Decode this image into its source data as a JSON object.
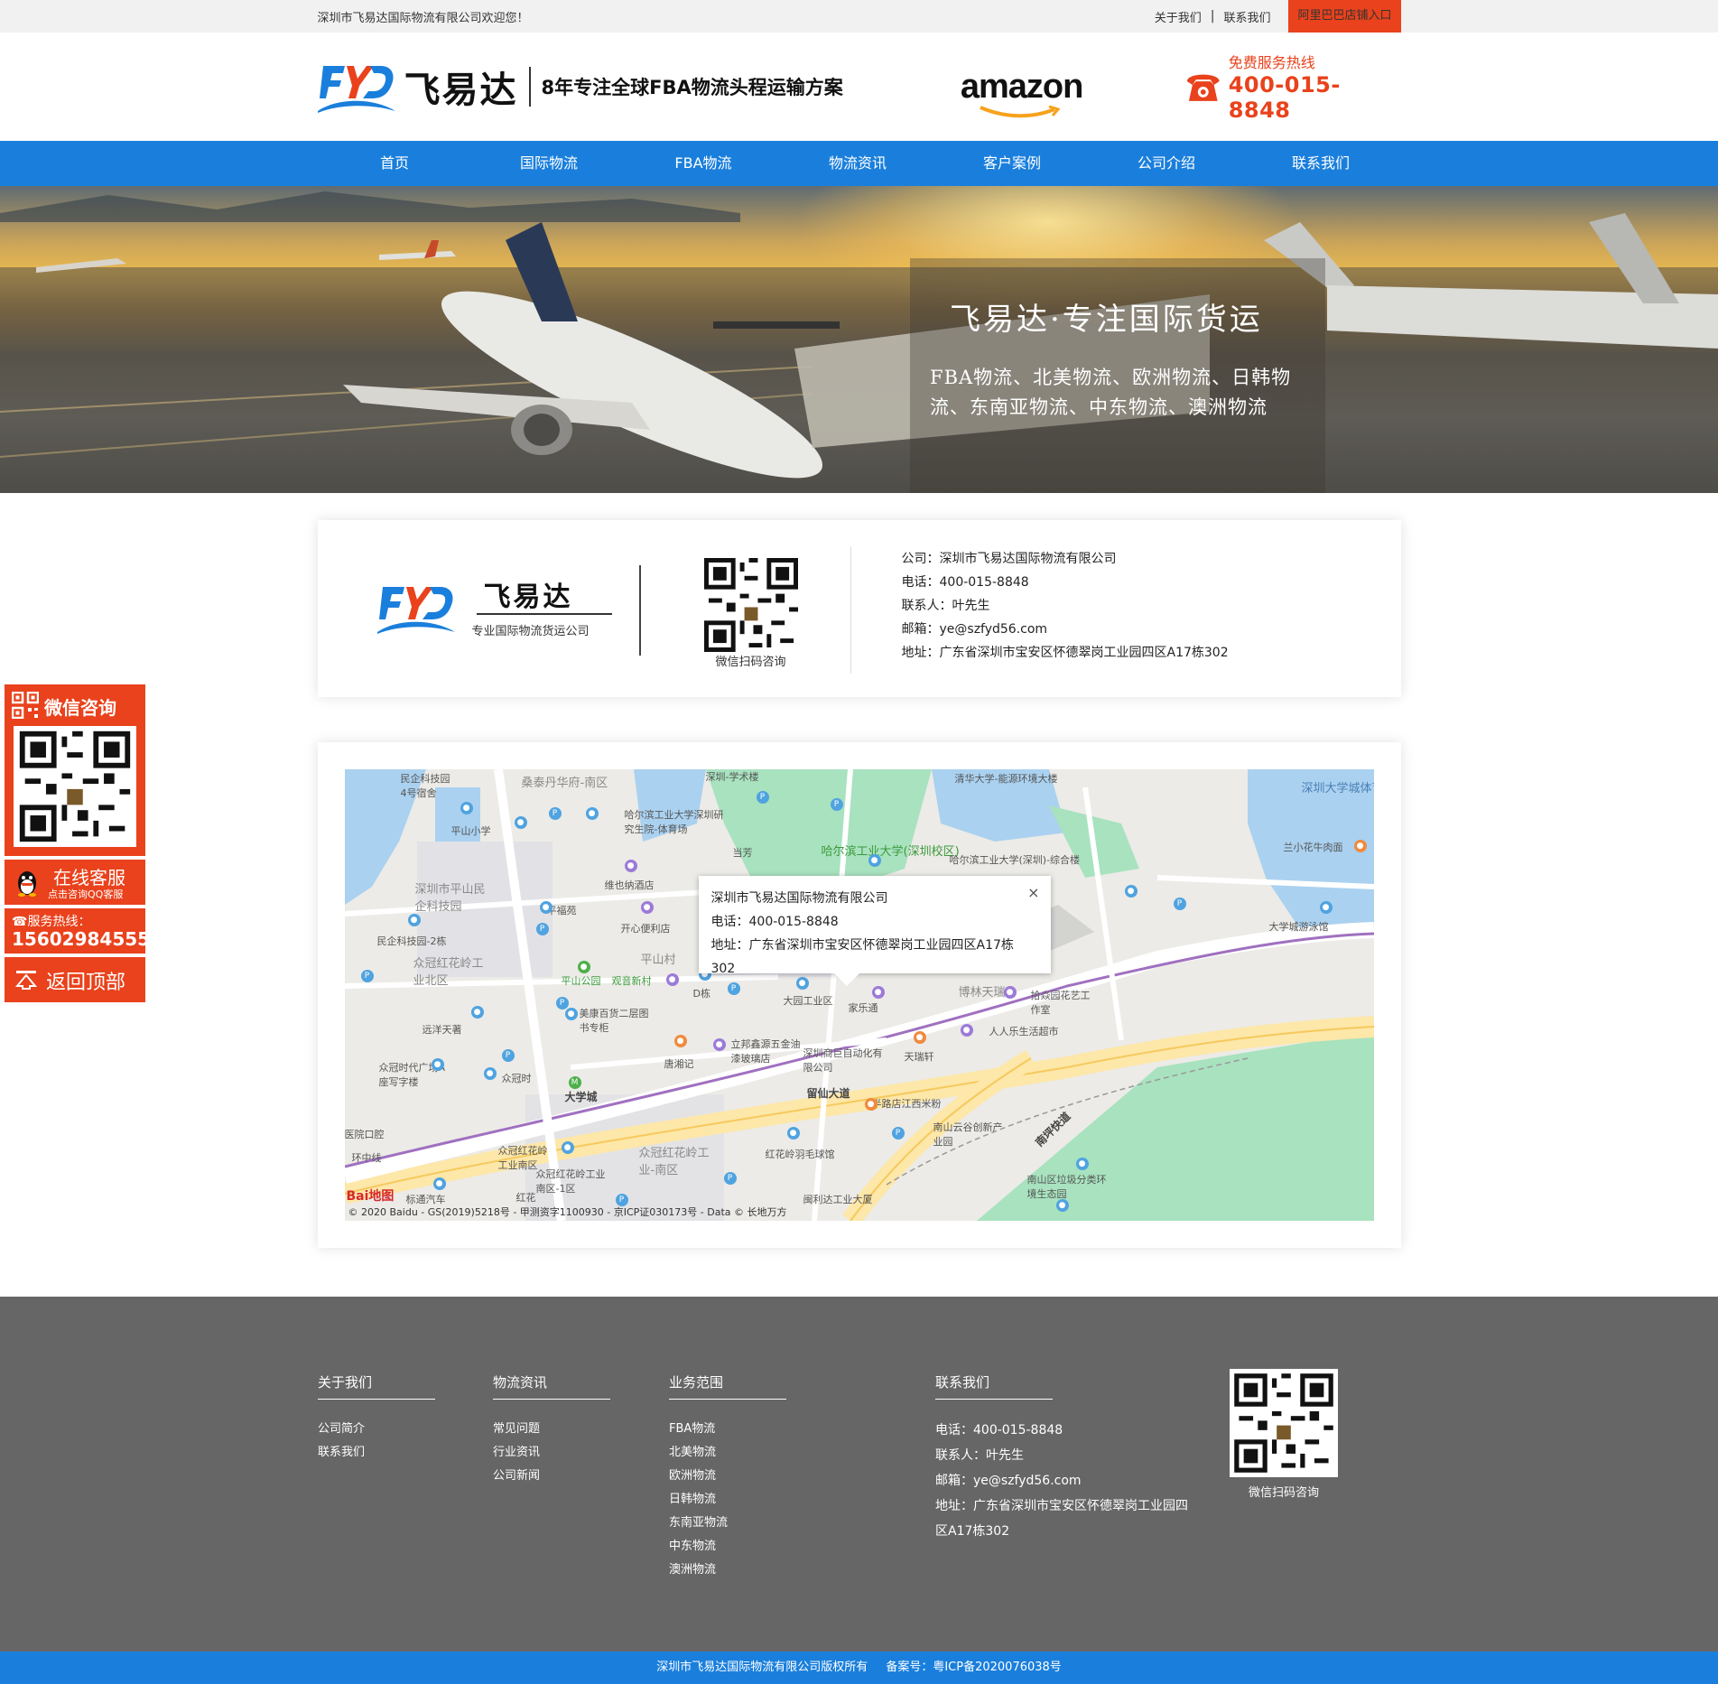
{
  "topbar": {
    "welcome": "深圳市飞易达国际物流有限公司欢迎您！",
    "links": [
      "关于我们",
      "联系我们"
    ],
    "alibaba": "阿里巴巴店铺入口"
  },
  "header": {
    "brand_name": "飞易达",
    "slogan": "8年专注全球FBA物流头程运输方案",
    "partner": "amazon",
    "hotline_label": "免费服务热线",
    "hotline_number": "400-015-8848"
  },
  "nav": [
    "首页",
    "国际物流",
    "FBA物流",
    "物流资讯",
    "客户案例",
    "公司介绍",
    "联系我们"
  ],
  "banner": {
    "title": "飞易达·专注国际货运",
    "subtitle": "FBA物流、北美物流、欧洲物流、日韩物流、东南亚物流、中东物流、澳洲物流"
  },
  "contact_card": {
    "brand_name": "飞易达",
    "brand_sub": "专业国际物流货运公司",
    "qr_caption": "微信扫码咨询",
    "lines": [
      "公司：深圳市飞易达国际物流有限公司",
      "电话：400-015-8848",
      "联系人：叶先生",
      "邮箱：ye@szfyd56.com",
      "地址：广东省深圳市宝安区怀德翠岗工业园四区A17栋302"
    ]
  },
  "map": {
    "popup": {
      "title": "深圳市飞易达国际物流有限公司",
      "phone": "电话：400-015-8848",
      "address": "地址：广东省深圳市宝安区怀德翠岗工业园四区A17栋302",
      "close": "×"
    },
    "labels": {
      "minqi_4": "民企科技园\n4号宿舍",
      "sangtai": "桑泰丹华府-南区",
      "harbin_sz": "哈尔滨工业大学深圳研究生院-体育场",
      "qinghua": "清华大学-能源环境大楼",
      "szu_gym": "深圳大学城体育中心",
      "pingshan_school": "平山小学",
      "dangfang": "当芳",
      "hit_sz": "哈尔滨工业大学(深圳校区)",
      "hit_sz2": "哈尔滨工业大学(深圳)-综合楼",
      "lanxiaohua": "兰小花牛肉面",
      "weiyena": "维也纳酒店",
      "pingshan_park_zone": "深圳市平山民企科技园",
      "pingfuyuan": "平福苑",
      "kaixin": "开心便利店",
      "daxuecheng_pool": "大学城游泳馆",
      "minqi_2": "民企科技园-2栋",
      "zhongguan_north": "众冠红花岭工业北区",
      "pingshan_village": "平山村",
      "pingshan_park": "平山公园",
      "guanyin": "观音新村",
      "d_building": "D栋",
      "dayuan": "大园工业区",
      "jialetong": "家乐通",
      "bolin": "博林天瑞",
      "lingyuan": "拾焱园花艺工作室",
      "yuanyang": "远洋天著",
      "meikang": "美康百货二层图书专柜",
      "renren": "人人乐生活超市",
      "zhongguan_a": "众冠时代广场A座写字楼",
      "zhongguan_time": "众冠时",
      "tangxiang": "唐湘记",
      "libang": "立邦鑫源五金油漆玻璃店",
      "shenzhen_auto": "深圳商巨自动化有限公司",
      "tianruixuan": "天瑞轩",
      "daxuecheng": "大学城",
      "liuxian": "留仙大道",
      "banlu": "半路店江西米粉",
      "nanping": "南坪快道",
      "nanshan_cloud": "南山云谷创新产业园",
      "zhongguan_south": "众冠红花岭工业南区",
      "zhongguan_1": "众冠红花岭工业南区-1区",
      "zhongguan_red": "众冠红花岭工业-南区",
      "honghualing": "红花岭羽毛球馆",
      "nanshan_waste": "南山区垃圾分类环境生态园",
      "huanzhong": "环中线",
      "yiyuan": "医院口腔",
      "biaotong": "标通汽车",
      "honghua": "红花",
      "lili": "闽利达工业大厦",
      "hui": "深圳-学术楼"
    },
    "copyright": "© 2020 Baidu - GS(2019)5218号 - 甲测资字1100930 - 京ICP证030173号 - Data © 长地万方",
    "baidu_logo": "Bai地图"
  },
  "side_float": {
    "wechat": "微信咨询",
    "online_service": "在线客服",
    "online_sub": "点击咨询QQ客服",
    "hotline_label": "服务热线：",
    "hotline_number": "15602984555",
    "back_top": "返回顶部"
  },
  "footer": {
    "about": {
      "title": "关于我们",
      "items": [
        "公司简介",
        "联系我们"
      ]
    },
    "news": {
      "title": "物流资讯",
      "items": [
        "常见问题",
        "行业资讯",
        "公司新闻"
      ]
    },
    "business": {
      "title": "业务范围",
      "items": [
        "FBA物流",
        "北美物流",
        "欧洲物流",
        "日韩物流",
        "东南亚物流",
        "中东物流",
        "澳洲物流"
      ]
    },
    "contact": {
      "title": "联系我们",
      "items": [
        "电话：400-015-8848",
        "联系人：叶先生",
        "邮箱：ye@szfyd56.com",
        "地址：广东省深圳市宝安区怀德翠岗工业园四区A17栋302"
      ]
    },
    "qr_caption": "微信扫码咨询"
  },
  "bottombar": {
    "copyright": "深圳市飞易达国际物流有限公司版权所有",
    "icp": "备案号：粤ICP备2020076038号"
  },
  "colors": {
    "brand_blue": "#1a7fdc",
    "accent_orange": "#e9421c",
    "footer_gray": "#666666"
  }
}
